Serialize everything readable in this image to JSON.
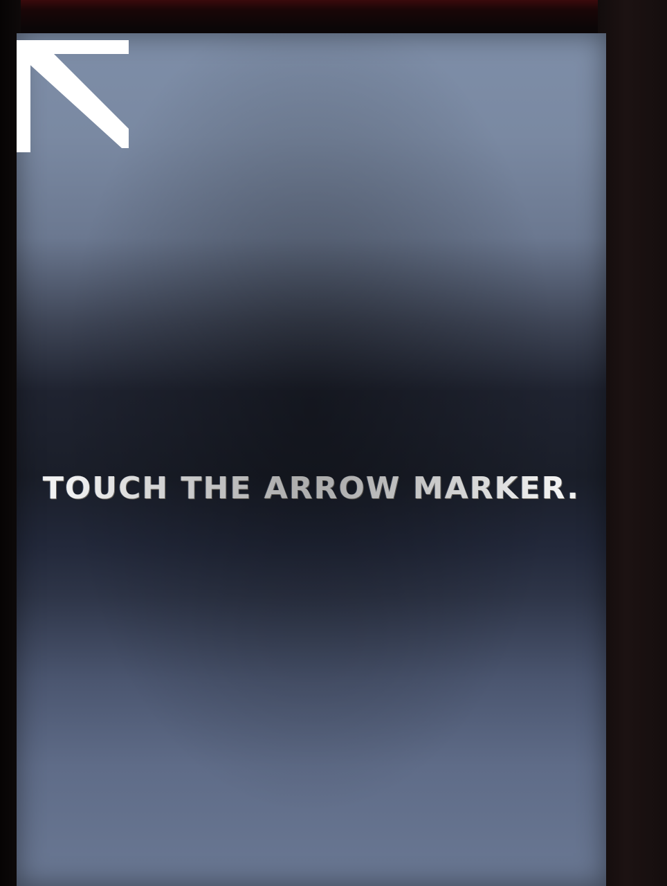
{
  "screen": {
    "prompt_text": "TOUCH THE ARROW MARKER.",
    "marker_icon": "arrow-up-left-icon"
  },
  "colors": {
    "marker": "#ffffff",
    "text": "#f2f2f2",
    "screen_top": "#7e8ea8",
    "screen_mid": "#1a1e29",
    "bezel": "#0a0707"
  }
}
